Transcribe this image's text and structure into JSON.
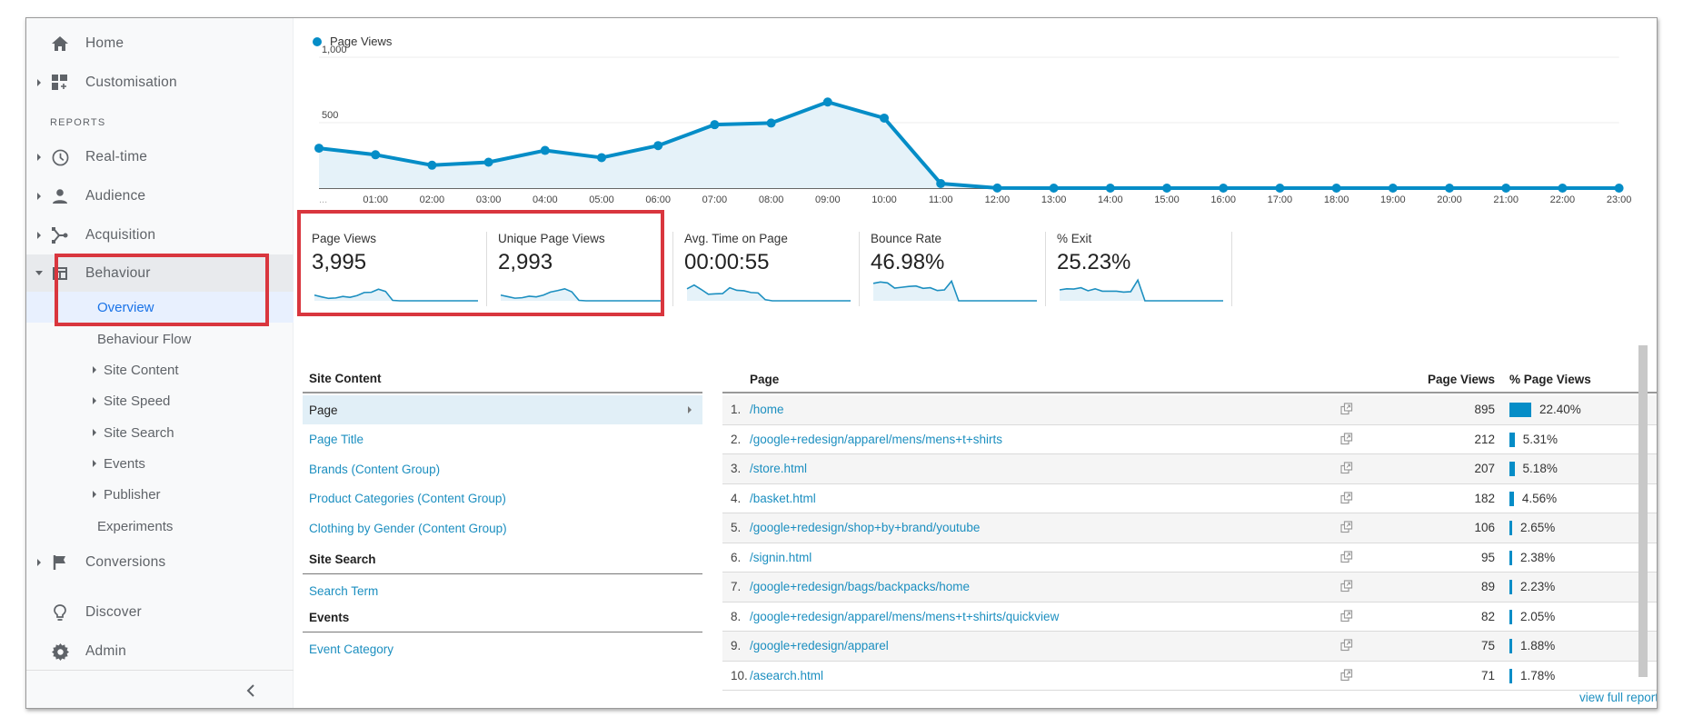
{
  "sidebar": {
    "home": "Home",
    "customisation": "Customisation",
    "reports_heading": "REPORTS",
    "realtime": "Real-time",
    "audience": "Audience",
    "acquisition": "Acquisition",
    "behaviour": "Behaviour",
    "behaviour_children": [
      {
        "label": "Overview",
        "active": true,
        "expandable": false
      },
      {
        "label": "Behaviour Flow",
        "expandable": false
      },
      {
        "label": "Site Content",
        "expandable": true
      },
      {
        "label": "Site Speed",
        "expandable": true
      },
      {
        "label": "Site Search",
        "expandable": true
      },
      {
        "label": "Events",
        "expandable": true
      },
      {
        "label": "Publisher",
        "expandable": true
      },
      {
        "label": "Experiments",
        "expandable": false
      }
    ],
    "conversions": "Conversions",
    "discover": "Discover",
    "admin": "Admin",
    "collapse_icon": "chevron-left-icon"
  },
  "chart_data": {
    "type": "line",
    "title": "",
    "legend": [
      "Page Views"
    ],
    "legend_position": "top-left",
    "series_color": "#058dc7",
    "x": [
      "...",
      "01:00",
      "02:00",
      "03:00",
      "04:00",
      "05:00",
      "06:00",
      "07:00",
      "08:00",
      "09:00",
      "10:00",
      "11:00",
      "12:00",
      "13:00",
      "14:00",
      "15:00",
      "16:00",
      "17:00",
      "18:00",
      "19:00",
      "20:00",
      "21:00",
      "22:00",
      "23:00"
    ],
    "series": [
      {
        "name": "Page Views",
        "values": [
          305,
          255,
          175,
          198,
          288,
          233,
          325,
          485,
          497,
          658,
          535,
          35,
          1,
          0,
          0,
          0,
          0,
          0,
          0,
          0,
          0,
          0,
          0,
          0
        ]
      }
    ],
    "y_ticks": [
      500,
      1000
    ],
    "y_tick_labels": [
      "500",
      "1,000"
    ],
    "ylim": [
      0,
      1000
    ],
    "grid": true,
    "xlabel": "",
    "ylabel": ""
  },
  "metrics": [
    {
      "label": "Page Views",
      "value": "3,995",
      "spark": [
        0.26,
        0.18,
        0.11,
        0.13,
        0.2,
        0.16,
        0.24,
        0.38,
        0.39,
        0.53,
        0.43,
        0.02,
        0,
        0,
        0,
        0,
        0,
        0,
        0,
        0,
        0,
        0,
        0,
        0
      ]
    },
    {
      "label": "Unique Page Views",
      "value": "2,993",
      "spark": [
        0.26,
        0.19,
        0.12,
        0.14,
        0.21,
        0.18,
        0.26,
        0.4,
        0.47,
        0.55,
        0.41,
        0.02,
        0,
        0,
        0,
        0,
        0,
        0,
        0,
        0,
        0,
        0,
        0,
        0
      ]
    },
    {
      "label": "Avg. Time on Page",
      "value": "00:00:55",
      "spark": [
        0.55,
        0.72,
        0.52,
        0.3,
        0.32,
        0.33,
        0.6,
        0.48,
        0.46,
        0.38,
        0.36,
        0.05,
        0,
        0,
        0,
        0,
        0,
        0,
        0,
        0,
        0,
        0,
        0,
        0
      ]
    },
    {
      "label": "Bounce Rate",
      "value": "46.98%",
      "spark": [
        0.8,
        0.86,
        0.82,
        0.58,
        0.62,
        0.66,
        0.68,
        0.57,
        0.6,
        0.47,
        0.5,
        0.9,
        0,
        0,
        0,
        0,
        0,
        0,
        0,
        0,
        0,
        0,
        0,
        0
      ]
    },
    {
      "label": "% Exit",
      "value": "25.23%",
      "spark": [
        0.5,
        0.55,
        0.54,
        0.6,
        0.46,
        0.55,
        0.44,
        0.44,
        0.44,
        0.4,
        0.42,
        0.95,
        0,
        0,
        0,
        0,
        0,
        0,
        0,
        0,
        0,
        0,
        0,
        0
      ]
    }
  ],
  "dimensions": {
    "site_content_heading": "Site Content",
    "site_content": [
      {
        "label": "Page",
        "selected": true
      },
      {
        "label": "Page Title"
      },
      {
        "label": "Brands (Content Group)"
      },
      {
        "label": "Product Categories (Content Group)"
      },
      {
        "label": "Clothing by Gender (Content Group)"
      }
    ],
    "site_search_heading": "Site Search",
    "site_search": [
      {
        "label": "Search Term"
      }
    ],
    "events_heading": "Events",
    "events": [
      {
        "label": "Event Category"
      }
    ]
  },
  "table": {
    "headers": {
      "page": "Page",
      "views": "Page Views",
      "pct": "% Page Views"
    },
    "rows": [
      {
        "rank": "1.",
        "page": "/home",
        "views": "895",
        "pct": "22.40%",
        "share": 22.4
      },
      {
        "rank": "2.",
        "page": "/google+redesign/apparel/mens/mens+t+shirts",
        "views": "212",
        "pct": "5.31%",
        "share": 5.31
      },
      {
        "rank": "3.",
        "page": "/store.html",
        "views": "207",
        "pct": "5.18%",
        "share": 5.18
      },
      {
        "rank": "4.",
        "page": "/basket.html",
        "views": "182",
        "pct": "4.56%",
        "share": 4.56
      },
      {
        "rank": "5.",
        "page": "/google+redesign/shop+by+brand/youtube",
        "views": "106",
        "pct": "2.65%",
        "share": 2.65
      },
      {
        "rank": "6.",
        "page": "/signin.html",
        "views": "95",
        "pct": "2.38%",
        "share": 2.38
      },
      {
        "rank": "7.",
        "page": "/google+redesign/bags/backpacks/home",
        "views": "89",
        "pct": "2.23%",
        "share": 2.23
      },
      {
        "rank": "8.",
        "page": "/google+redesign/apparel/mens/mens+t+shirts/quickview",
        "views": "82",
        "pct": "2.05%",
        "share": 2.05
      },
      {
        "rank": "9.",
        "page": "/google+redesign/apparel",
        "views": "75",
        "pct": "1.88%",
        "share": 1.88
      },
      {
        "rank": "10.",
        "page": "/asearch.html",
        "views": "71",
        "pct": "1.78%",
        "share": 1.78
      }
    ],
    "view_full_report": "view full report"
  },
  "colors": {
    "accent": "#058dc7",
    "link": "#1c8fc0",
    "highlight_box": "#d9363e",
    "active_nav": "#1a73e8"
  }
}
